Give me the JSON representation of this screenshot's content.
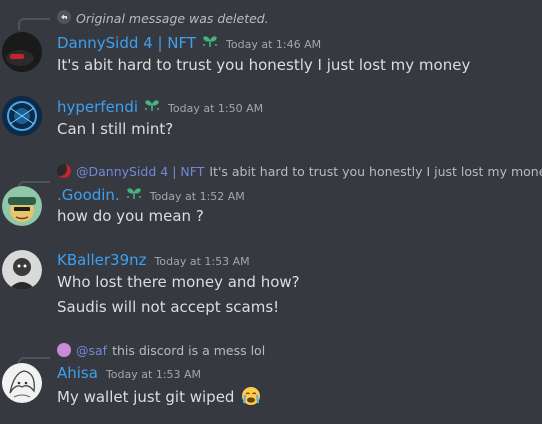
{
  "messages": [
    {
      "reply": {
        "text": "Original message was deleted.",
        "icon": "reply-arrow-icon"
      },
      "username": "DannySidd 4 | NFT",
      "badge_icon": "sprout-icon",
      "timestamp": "Today at 1:46 AM",
      "lines": [
        "It's abit hard to trust you honestly I just lost my money"
      ]
    },
    {
      "username": "hyperfendi",
      "badge_icon": "sprout-icon",
      "timestamp": "Today at 1:50 AM",
      "lines": [
        "Can I still mint?"
      ]
    },
    {
      "reply": {
        "mention": "@DannySidd 4 | NFT",
        "text": "It's abit hard to trust you honestly I just lost my money"
      },
      "username": ".Goodin.",
      "badge_icon": "sprout-icon",
      "timestamp": "Today at 1:52 AM",
      "lines": [
        "how do you mean ?"
      ]
    },
    {
      "username": "KBaller39nz",
      "timestamp": "Today at 1:53 AM",
      "lines": [
        "Who lost there money and how?",
        "Saudis will not accept scams!"
      ]
    },
    {
      "reply": {
        "mention": "@saf",
        "text": "this discord is a mess lol"
      },
      "username": "Ahisa",
      "timestamp": "Today at 1:53 AM",
      "lines": [
        "My wallet just git wiped"
      ],
      "emoji": "crying-face-emoji"
    }
  ],
  "colors": {
    "background": "#36393f",
    "username": "#3ea0f0",
    "text": "#dcddde",
    "mention": "#7289da",
    "badge": "#43b581"
  }
}
